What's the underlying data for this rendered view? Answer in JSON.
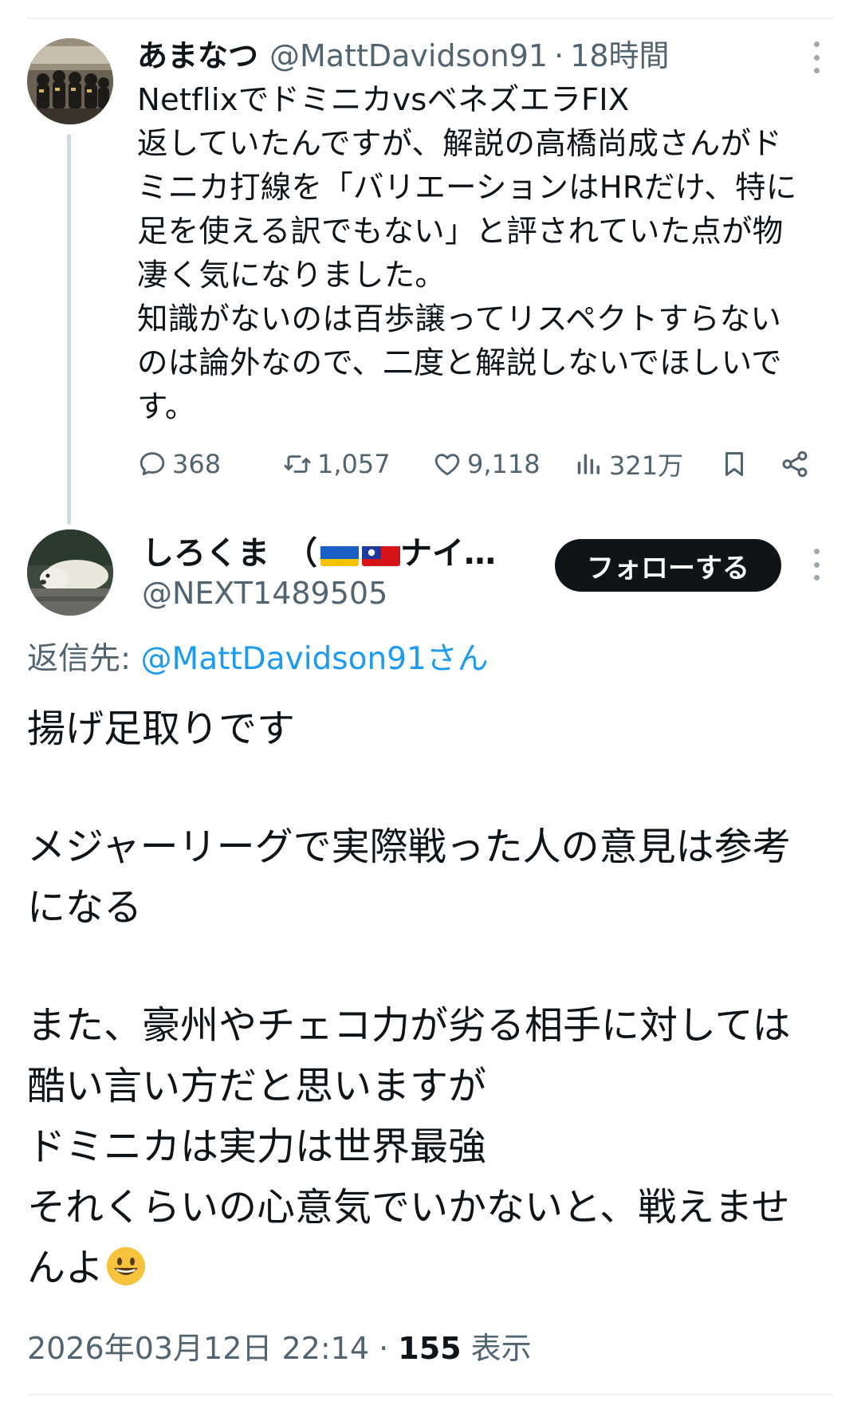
{
  "tweet1": {
    "display_name": "あまなつ",
    "handle": "@MattDavidson91",
    "separator": "·",
    "time": "18時間",
    "body_lines": [
      "NetflixでドミニカvsベネズエラFIX",
      "返していたんですが、解説の高橋尚成さんがド",
      "ミニカ打線を「バリエーションはHRだけ、特に",
      "足を使える訳でもない」と評されていた点が物",
      "凄く気になりました。",
      "知識がないのは百歩譲ってリスペクトすらない",
      "のは論外なので、二度と解説しないでほしいで",
      "す。"
    ],
    "actions": {
      "reply_count": "368",
      "retweet_count": "1,057",
      "like_count": "9,118",
      "view_count": "321万"
    },
    "icons": {
      "reply": "reply-icon",
      "retweet": "retweet-icon",
      "like": "heart-icon",
      "views": "views-bar-icon",
      "bookmark": "bookmark-icon",
      "share": "share-icon",
      "more": "more-vertical-icon"
    }
  },
  "tweet2": {
    "display_name": "しろくま　（",
    "display_name_suffix": "ナイ…",
    "flags": [
      "ukraine-flag",
      "taiwan-flag"
    ],
    "handle": "@NEXT1489505",
    "follow_label": "フォローする",
    "reply_to_label": "返信先: ",
    "reply_to_handle": "@MattDavidson91さん",
    "body_lines": [
      "揚げ足取りです",
      "",
      "メジャーリーグで実際戦った人の意見は参考",
      "になる",
      "",
      "また、豪州やチェコ力が劣る相手に対しては",
      "酷い言い方だと思いますが",
      "ドミニカは実力は世界最強",
      "それくらいの心意気でいかないと、戦えませ",
      "んよ"
    ],
    "ending_emoji": "grinning-face-emoji",
    "timestamp": "2026年03月12日 22:14",
    "meta_separator": " · ",
    "views_count": "155",
    "views_label": " 表示"
  },
  "colors": {
    "text_primary": "#0f1419",
    "text_secondary": "#536471",
    "link": "#1d9bf0",
    "thread_line": "#cfd9de",
    "follow_bg": "#0f1419",
    "follow_text": "#ffffff"
  }
}
